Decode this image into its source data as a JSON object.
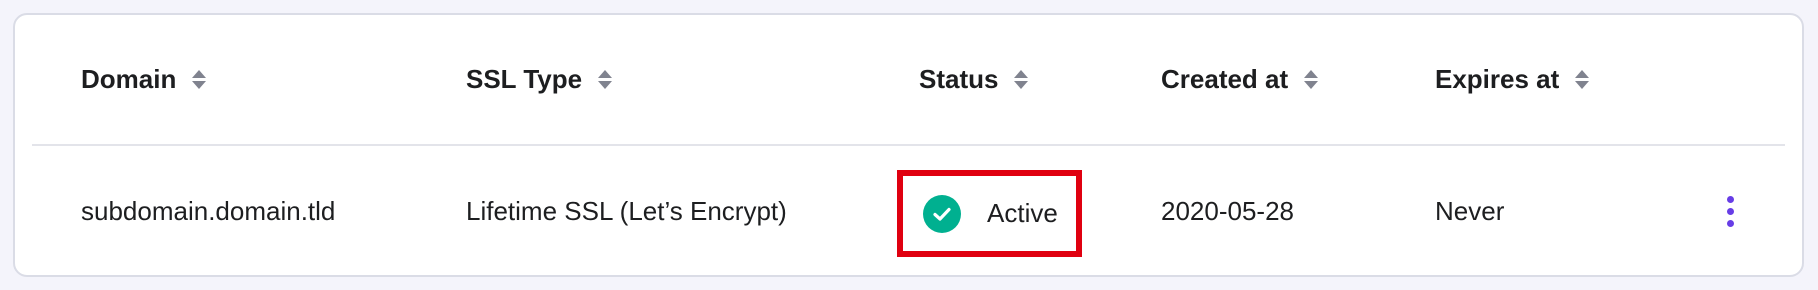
{
  "colors": {
    "page_bg": "#f4f4fb",
    "card_bg": "#ffffff",
    "text": "#1d1e20",
    "sort_icon": "#80838f",
    "status_active": "#00b090",
    "highlight_box": "#e00010",
    "menu_dots": "#673de6"
  },
  "table": {
    "columns": [
      {
        "label": "Domain",
        "sortable": true,
        "icon": "sort-icon"
      },
      {
        "label": "SSL Type",
        "sortable": true,
        "icon": "sort-icon"
      },
      {
        "label": "Status",
        "sortable": true,
        "icon": "sort-icon"
      },
      {
        "label": "Created at",
        "sortable": true,
        "icon": "sort-icon"
      },
      {
        "label": "Expires at",
        "sortable": true,
        "icon": "sort-icon"
      }
    ],
    "rows": [
      {
        "domain": "subdomain.domain.tld",
        "ssl_type": "Lifetime SSL (Let’s Encrypt)",
        "status": "Active",
        "status_icon": "check-circle-icon",
        "created_at": "2020-05-28",
        "expires_at": "Never",
        "actions_icon": "more-vertical-icon"
      }
    ]
  }
}
